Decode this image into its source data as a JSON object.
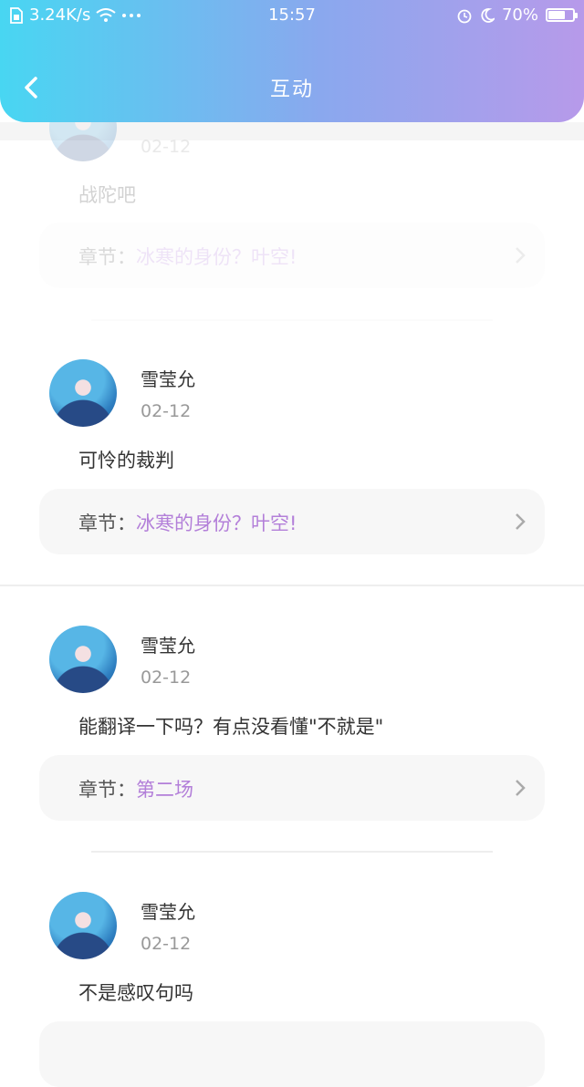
{
  "status_bar": {
    "network_speed": "3.24K/s",
    "time": "15:57",
    "battery_percent": "70%",
    "battery_level": 0.7
  },
  "nav": {
    "title": "互动"
  },
  "chapter_prefix": "章节：",
  "comments": [
    {
      "date": "02-12",
      "content": "战陀吧",
      "chapter": "冰寒的身份？叶空!"
    },
    {
      "name": "雪莹允",
      "date": "02-12",
      "content": "可怜的裁判",
      "chapter": "冰寒的身份？叶空!"
    },
    {
      "name": "雪莹允",
      "date": "02-12",
      "content": "能翻译一下吗？有点没看懂\"不就是\"",
      "chapter": "第二场"
    },
    {
      "name": "雪莹允",
      "date": "02-12",
      "content": "不是感叹句吗"
    }
  ]
}
